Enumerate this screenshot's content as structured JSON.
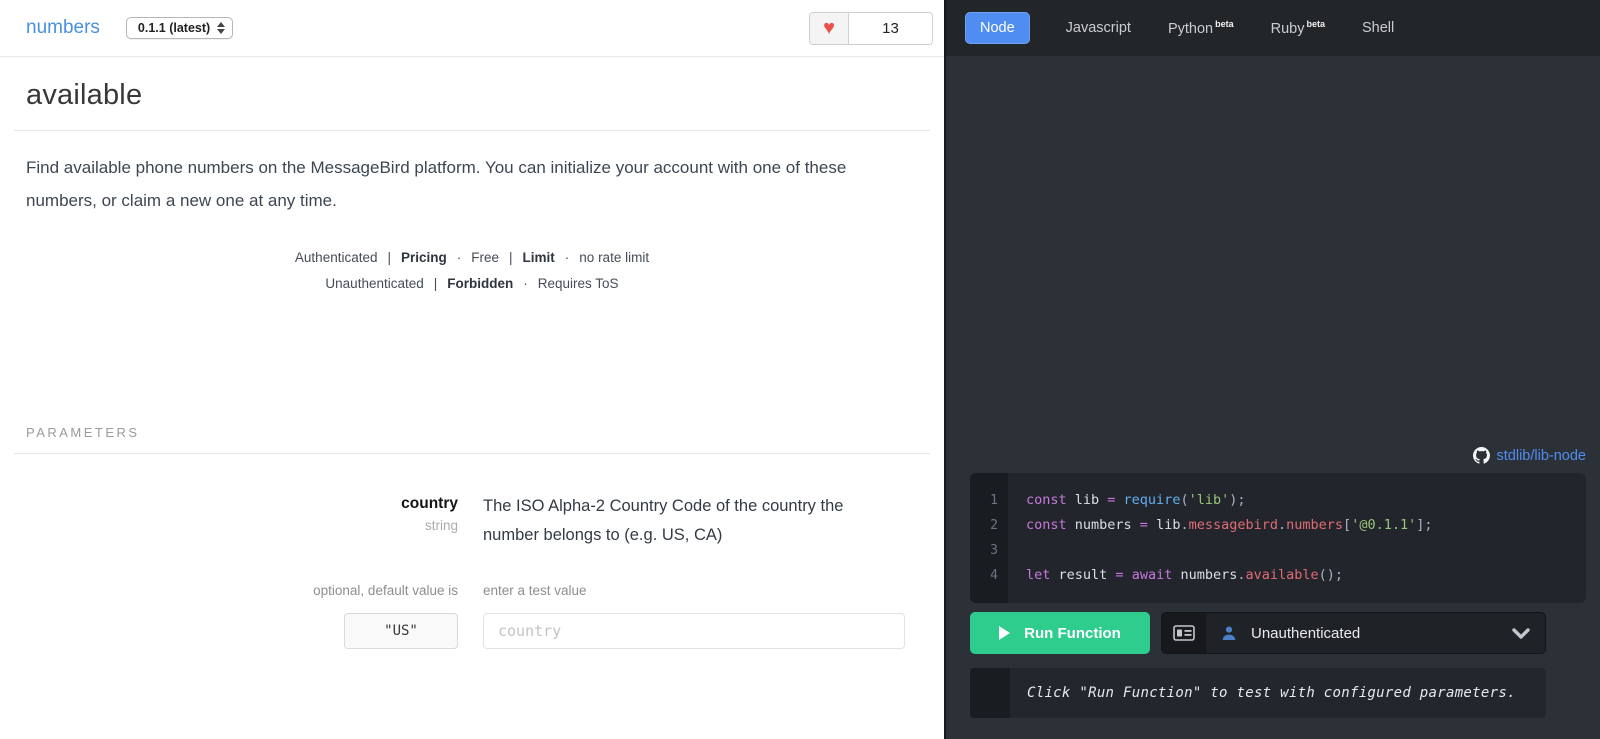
{
  "header": {
    "title": "numbers",
    "version": "0.1.1 (latest)",
    "likes": "13"
  },
  "main": {
    "function_name": "available",
    "description": "Find available phone numbers on the MessageBird platform. You can initialize your account with one of these numbers, or claim a new one at any time.",
    "auth_lines": [
      [
        {
          "t": "Authenticated"
        },
        {
          "t": "|"
        },
        {
          "t": "Pricing",
          "b": true
        },
        {
          "t": "·"
        },
        {
          "t": "Free"
        },
        {
          "t": "|"
        },
        {
          "t": "Limit",
          "b": true
        },
        {
          "t": "·"
        },
        {
          "t": "no rate limit"
        }
      ],
      [
        {
          "t": "Unauthenticated"
        },
        {
          "t": "|"
        },
        {
          "t": "Forbidden",
          "b": true
        },
        {
          "t": "·"
        },
        {
          "t": "Requires ToS"
        }
      ]
    ],
    "parameters_heading": "PARAMETERS",
    "parameter": {
      "name": "country",
      "type": "string",
      "description": "The ISO Alpha-2 Country Code of the country the number belongs to (e.g. US, CA)",
      "optional_label": "optional, default value is",
      "default_value": "\"US\"",
      "test_label": "enter a test value",
      "placeholder": "country"
    }
  },
  "code_panel": {
    "tabs": [
      {
        "label": "Node",
        "active": true,
        "beta": null
      },
      {
        "label": "Javascript",
        "active": false,
        "beta": null
      },
      {
        "label": "Python",
        "active": false,
        "beta": "beta"
      },
      {
        "label": "Ruby",
        "active": false,
        "beta": "beta"
      },
      {
        "label": "Shell",
        "active": false,
        "beta": null
      }
    ],
    "repo_link": "stdlib/lib-node",
    "code_lines": [
      [
        {
          "t": "const",
          "c": "kw"
        },
        {
          "t": " lib ",
          "c": "id"
        },
        {
          "t": "= ",
          "c": "kw"
        },
        {
          "t": "require",
          "c": "fn"
        },
        {
          "t": "(",
          "c": "pun"
        },
        {
          "t": "'lib'",
          "c": "str"
        },
        {
          "t": ");",
          "c": "pun"
        }
      ],
      [
        {
          "t": "const",
          "c": "kw"
        },
        {
          "t": " numbers ",
          "c": "id"
        },
        {
          "t": "= ",
          "c": "kw"
        },
        {
          "t": "lib",
          "c": "id"
        },
        {
          "t": ".",
          "c": "pun"
        },
        {
          "t": "messagebird",
          "c": "prop"
        },
        {
          "t": ".",
          "c": "pun"
        },
        {
          "t": "numbers",
          "c": "prop"
        },
        {
          "t": "[",
          "c": "pun"
        },
        {
          "t": "'@0.1.1'",
          "c": "str"
        },
        {
          "t": "];",
          "c": "pun"
        }
      ],
      [],
      [
        {
          "t": "let",
          "c": "kw"
        },
        {
          "t": " result ",
          "c": "id"
        },
        {
          "t": "= ",
          "c": "kw"
        },
        {
          "t": "await",
          "c": "kw"
        },
        {
          "t": " numbers",
          "c": "id"
        },
        {
          "t": ".",
          "c": "pun"
        },
        {
          "t": "available",
          "c": "prop"
        },
        {
          "t": "();",
          "c": "pun"
        }
      ]
    ],
    "run_button": "Run Function",
    "auth_selector": "Unauthenticated",
    "result_message": "Click \"Run Function\" to test with configured parameters."
  },
  "colors": {
    "accent_blue": "#4f8df2",
    "run_green": "#2ecd8d",
    "heart_red": "#e8524a"
  }
}
